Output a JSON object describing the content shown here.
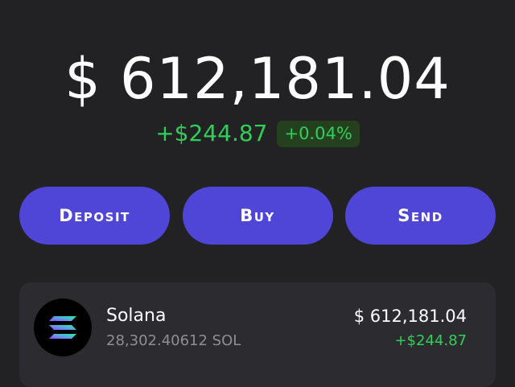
{
  "portfolio": {
    "balance": "$ 612,181.04",
    "change_amount": "+$244.87",
    "change_percent": "+0.04%"
  },
  "actions": {
    "deposit_label": "Deposit",
    "buy_label": "Buy",
    "send_label": "Send"
  },
  "assets": [
    {
      "name": "Solana",
      "quantity": "28,302.40612 SOL",
      "value": "$ 612,181.04",
      "change": "+$244.87",
      "icon": "solana-logo-icon"
    }
  ],
  "colors": {
    "background": "#222123",
    "accent": "#4f46d8",
    "positive": "#2ed158",
    "positive_badge_bg": "#24401f",
    "card": "#2b2b30"
  }
}
